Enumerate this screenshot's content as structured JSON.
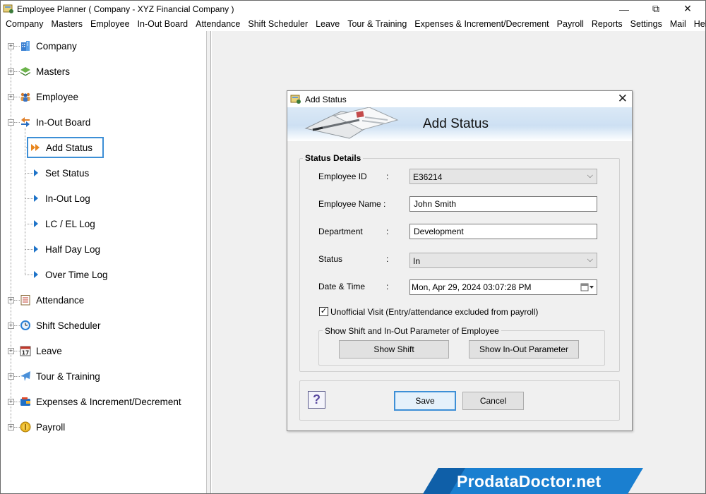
{
  "window": {
    "title": "Employee Planner ( Company - XYZ Financial Company )",
    "minimize_glyph": "—",
    "maximize_glyph": "⧉",
    "close_glyph": "✕"
  },
  "menu": [
    "Company",
    "Masters",
    "Employee",
    "In-Out Board",
    "Attendance",
    "Shift Scheduler",
    "Leave",
    "Tour & Training",
    "Expenses & Increment/Decrement",
    "Payroll",
    "Reports",
    "Settings",
    "Mail",
    "Help"
  ],
  "sidebar": {
    "items": [
      {
        "label": "Company",
        "icon": "building-icon"
      },
      {
        "label": "Masters",
        "icon": "layers-icon"
      },
      {
        "label": "Employee",
        "icon": "people-icon"
      },
      {
        "label": "In-Out Board",
        "icon": "in-out-arrows-icon"
      },
      {
        "label": "Attendance",
        "icon": "checklist-icon"
      },
      {
        "label": "Shift Scheduler",
        "icon": "clock-icon"
      },
      {
        "label": "Leave",
        "icon": "calendar-icon"
      },
      {
        "label": "Tour & Training",
        "icon": "airplane-icon"
      },
      {
        "label": "Expenses & Increment/Decrement",
        "icon": "wallet-icon"
      },
      {
        "label": "Payroll",
        "icon": "coin-icon"
      }
    ],
    "sub_items": [
      {
        "label": "Add Status",
        "selected": true
      },
      {
        "label": "Set Status"
      },
      {
        "label": "In-Out Log"
      },
      {
        "label": "LC / EL Log"
      },
      {
        "label": "Half Day Log"
      },
      {
        "label": "Over Time Log"
      }
    ],
    "calendar_day": "17"
  },
  "dialog": {
    "window_title": "Add Status",
    "heading": "Add Status",
    "close_glyph": "✕",
    "group_label": "Status Details",
    "fields": {
      "employee_id_label": "Employee ID",
      "employee_id_value": "E36214",
      "employee_name_label": "Employee Name :",
      "employee_name_value": "John Smith",
      "department_label": "Department",
      "department_value": "Development",
      "status_label": "Status",
      "status_value": "In",
      "datetime_label": "Date & Time",
      "datetime_value": "Mon, Apr 29, 2024 03:07:28 PM",
      "colon": ":"
    },
    "unofficial_visit_label": "Unofficial Visit (Entry/attendance excluded from payroll)",
    "unofficial_visit_checked": true,
    "shift_group_label": "Show Shift and In-Out Parameter of Employee",
    "show_shift_button": "Show Shift",
    "show_inout_button": "Show In-Out Parameter",
    "help_glyph": "?",
    "save_button": "Save",
    "cancel_button": "Cancel"
  },
  "watermark": "ProdataDoctor.net",
  "colors": {
    "accent": "#3d8fd6",
    "workspace": "#f0f0f0",
    "tree_arrow": "#1e73c8",
    "watermark_bg": "#1a7fd0"
  }
}
